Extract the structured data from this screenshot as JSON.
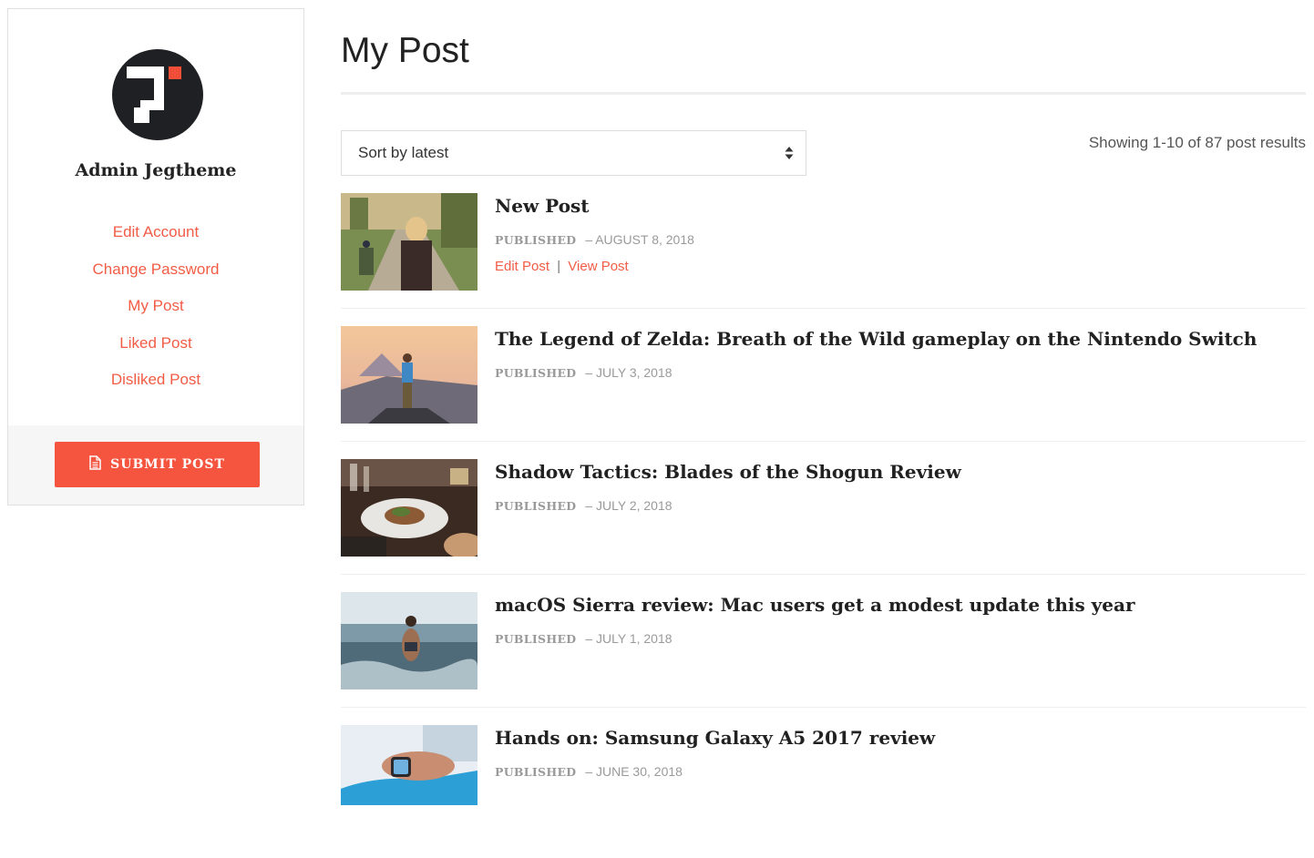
{
  "sidebar": {
    "user_name": "Admin Jegtheme",
    "nav": [
      {
        "label": "Edit Account"
      },
      {
        "label": "Change Password"
      },
      {
        "label": "My Post"
      },
      {
        "label": "Liked Post"
      },
      {
        "label": "Disliked Post"
      }
    ],
    "submit_label": "SUBMIT POST"
  },
  "main": {
    "title": "My Post",
    "sort": {
      "value": "Sort by latest"
    },
    "results_text": "Showing 1-10 of 87 post results",
    "posts": [
      {
        "title": "New Post",
        "status": "PUBLISHED",
        "date": "– AUGUST 8, 2018",
        "edit_label": "Edit Post",
        "separator": "|",
        "view_label": "View Post"
      },
      {
        "title": "The Legend of Zelda: Breath of the Wild gameplay on the Nintendo Switch",
        "status": "PUBLISHED",
        "date": "– JULY 3, 2018"
      },
      {
        "title": "Shadow Tactics: Blades of the Shogun Review",
        "status": "PUBLISHED",
        "date": "– JULY 2, 2018"
      },
      {
        "title": "macOS Sierra review: Mac users get a modest update this year",
        "status": "PUBLISHED",
        "date": "– JULY 1, 2018"
      },
      {
        "title": "Hands on: Samsung Galaxy A5 2017 review",
        "status": "PUBLISHED",
        "date": "– JUNE 30, 2018"
      }
    ]
  },
  "colors": {
    "accent": "#f5543e",
    "link": "#f25c45",
    "muted": "#9a9a9a"
  }
}
